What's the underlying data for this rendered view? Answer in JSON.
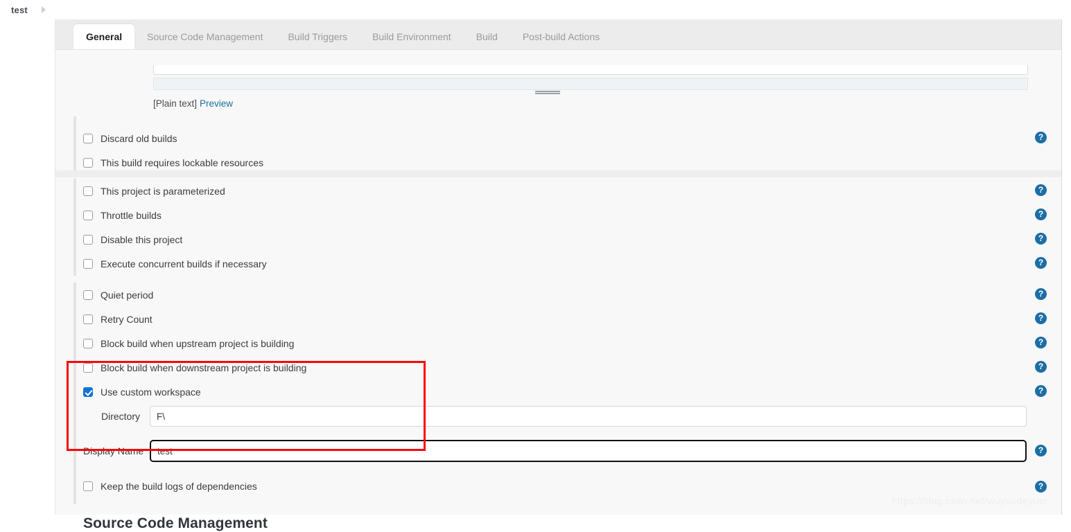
{
  "breadcrumb": {
    "items": [
      "test"
    ],
    "separator_icon": "chevron-right-icon"
  },
  "tabs": [
    {
      "label": "General",
      "active": true
    },
    {
      "label": "Source Code Management",
      "active": false
    },
    {
      "label": "Build Triggers",
      "active": false
    },
    {
      "label": "Build Environment",
      "active": false
    },
    {
      "label": "Build",
      "active": false
    },
    {
      "label": "Post-build Actions",
      "active": false
    }
  ],
  "description_field": {
    "markup_note": "[Plain text]",
    "preview_link": "Preview",
    "resize_handle_icon": "resize-grip-icon"
  },
  "checkbox_groups": [
    {
      "rows": [
        {
          "label": "Discard old builds",
          "checked": false,
          "help": true
        },
        {
          "label": "This build requires lockable resources",
          "checked": false,
          "help": false
        }
      ]
    },
    {
      "rows": [
        {
          "label": "This project is parameterized",
          "checked": false,
          "help": true
        },
        {
          "label": "Throttle builds",
          "checked": false,
          "help": true
        },
        {
          "label": "Disable this project",
          "checked": false,
          "help": true
        },
        {
          "label": "Execute concurrent builds if necessary",
          "checked": false,
          "help": true
        }
      ]
    },
    {
      "rows": [
        {
          "label": "Quiet period",
          "checked": false,
          "help": true
        },
        {
          "label": "Retry Count",
          "checked": false,
          "help": true
        },
        {
          "label": "Block build when upstream project is building",
          "checked": false,
          "help": true
        },
        {
          "label": "Block build when downstream project is building",
          "checked": false,
          "help": true
        }
      ]
    }
  ],
  "custom_workspace": {
    "checkbox_label": "Use custom workspace",
    "checked": true,
    "help": true,
    "fields": [
      {
        "label": "Directory",
        "value": "F\\",
        "placeholder": "",
        "focused": false,
        "help": false
      },
      {
        "label": "Display Name",
        "value": "test",
        "placeholder": "",
        "focused": true,
        "help": true
      }
    ]
  },
  "trailing_checkbox": {
    "label": "Keep the build logs of dependencies",
    "checked": false,
    "help": true
  },
  "section_heading": "Source Code Management",
  "watermark": "https://blog.csdn.net/wuyoudeyuer",
  "help_icon_glyph": "?",
  "colors": {
    "accent_blue": "#1273d4",
    "help_blue": "#1c6ea4",
    "link_blue": "#1d6fa5",
    "highlight_red": "#fb0707",
    "panel_bg": "#f8f8f8",
    "tabbar_bg": "#ececec"
  }
}
